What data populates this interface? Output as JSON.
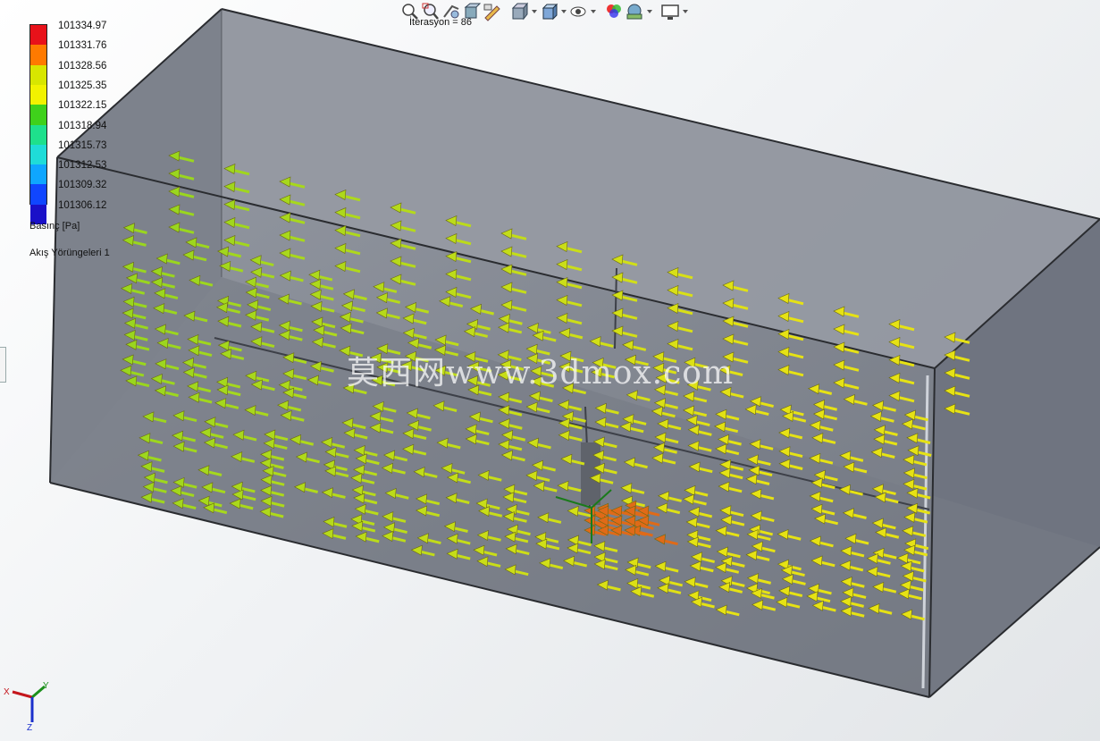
{
  "toolbar": {
    "items": [
      {
        "name": "zoom-to-fit-icon"
      },
      {
        "name": "zoom-to-area-icon"
      },
      {
        "name": "previous-view-icon"
      },
      {
        "name": "section-view-icon"
      },
      {
        "name": "dynamic-annotation-icon"
      },
      {
        "name": "view-orientation-icon",
        "dropdown": true
      },
      {
        "name": "display-style-icon",
        "dropdown": true
      },
      {
        "name": "hide-show-items-icon",
        "dropdown": true
      },
      {
        "name": "edit-appearance-icon"
      },
      {
        "name": "apply-scene-icon",
        "dropdown": true
      },
      {
        "name": "view-settings-icon",
        "dropdown": true
      }
    ]
  },
  "iteration": "İterasyon = 86",
  "legend": {
    "values": [
      "101334.97",
      "101331.76",
      "101328.56",
      "101325.35",
      "101322.15",
      "101318.94",
      "101315.73",
      "101312.53",
      "101309.32",
      "101306.12"
    ],
    "colors": [
      "#e8121a",
      "#ff7a00",
      "#d8e600",
      "#f2f200",
      "#3fd11b",
      "#1ee08c",
      "#1fdcd8",
      "#0fa6ff",
      "#1046ff",
      "#1a10c8"
    ],
    "title": "Basınç [Pa]",
    "trajectory": "Akış Yörüngeleri 1"
  },
  "watermark": "莫西网www.3dmox.com",
  "triad_labels": {
    "x": "X",
    "y": "Y",
    "z": "Z"
  }
}
